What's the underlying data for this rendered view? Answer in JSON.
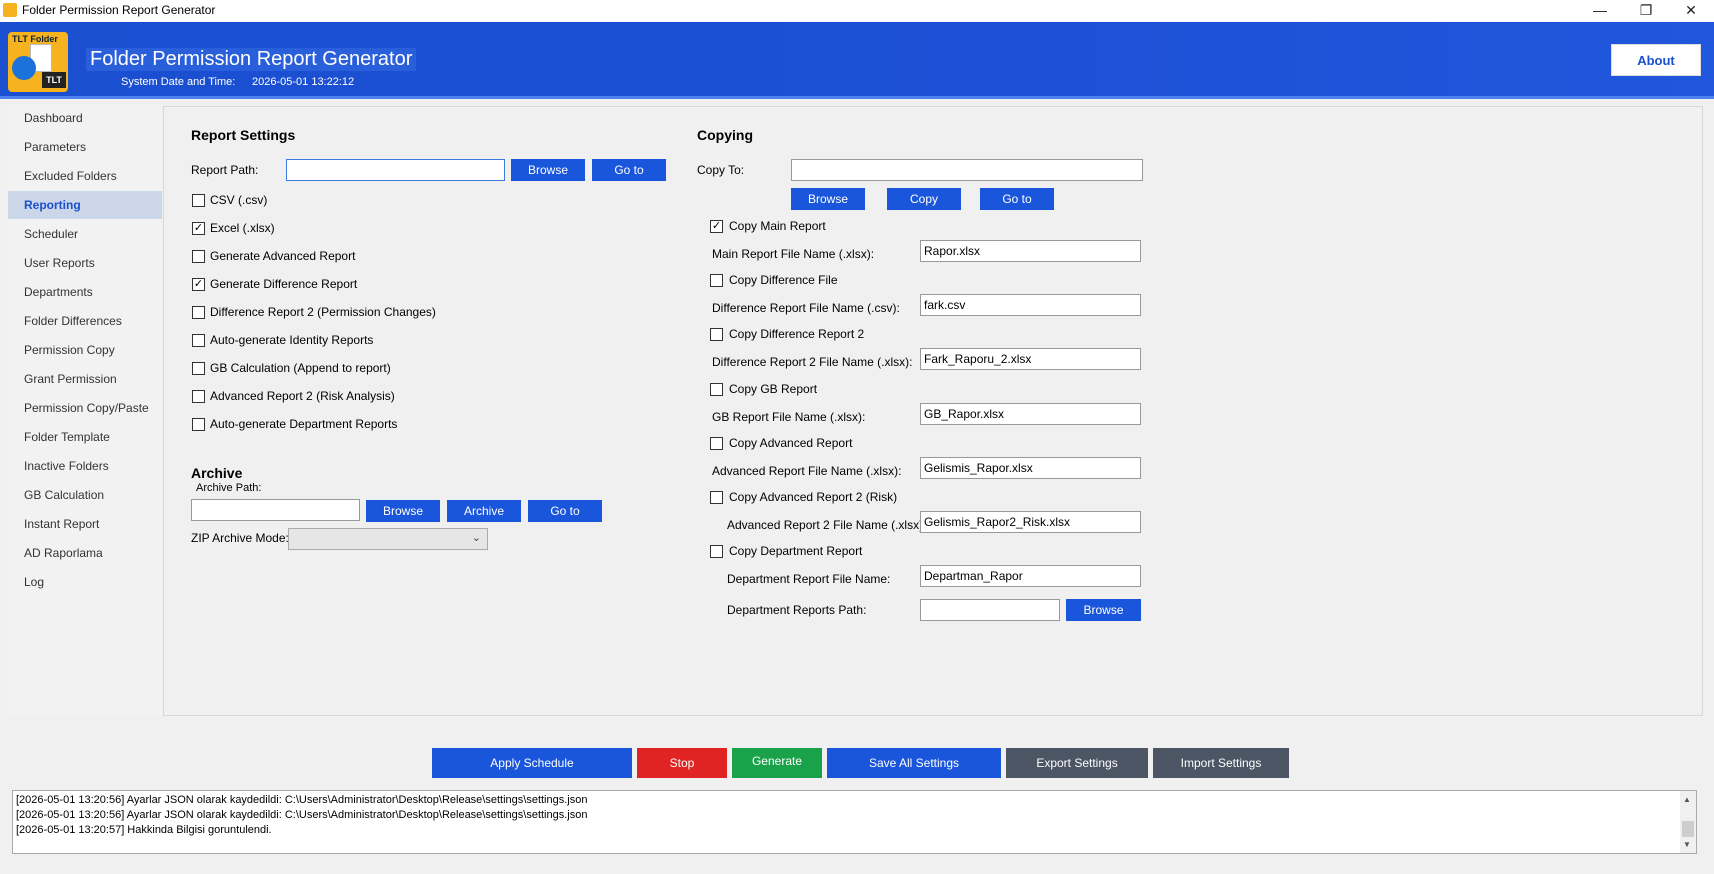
{
  "window": {
    "title": "Folder Permission Report Generator",
    "minimize": "—",
    "restore": "❐",
    "close": "✕"
  },
  "header": {
    "logo_text": "TLT Folder",
    "logo_badge": "TLT",
    "title": "Folder Permission Report Generator",
    "datetime_label": "System Date and Time:",
    "datetime_value": "2026-05-01 13:22:12",
    "about_label": "About"
  },
  "sidebar": {
    "items": [
      {
        "label": "Dashboard"
      },
      {
        "label": "Parameters"
      },
      {
        "label": "Excluded Folders"
      },
      {
        "label": "Reporting"
      },
      {
        "label": "Scheduler"
      },
      {
        "label": "User Reports"
      },
      {
        "label": "Departments"
      },
      {
        "label": "Folder Differences"
      },
      {
        "label": "Permission Copy"
      },
      {
        "label": "Grant Permission"
      },
      {
        "label": "Permission Copy/Paste"
      },
      {
        "label": "Folder Template"
      },
      {
        "label": "Inactive Folders"
      },
      {
        "label": "GB Calculation"
      },
      {
        "label": "Instant Report"
      },
      {
        "label": "AD Raporlama"
      },
      {
        "label": "Log"
      }
    ],
    "active": "Reporting"
  },
  "report_settings": {
    "heading": "Report Settings",
    "path_label": "Report Path:",
    "path_value": "",
    "browse_label": "Browse",
    "goto_label": "Go to",
    "options": [
      {
        "label": "CSV (.csv)",
        "checked": false,
        "mark": ""
      },
      {
        "label": "Excel (.xlsx)",
        "checked": true,
        "mark": "✓"
      },
      {
        "label": "Generate Advanced Report",
        "checked": false,
        "mark": ""
      },
      {
        "label": "Generate Difference Report",
        "checked": true,
        "mark": "✓"
      },
      {
        "label": "Difference Report 2 (Permission Changes)",
        "checked": false,
        "mark": ""
      },
      {
        "label": "Auto-generate Identity Reports",
        "checked": false,
        "mark": ""
      },
      {
        "label": "GB Calculation (Append to report)",
        "checked": false,
        "mark": ""
      },
      {
        "label": "Advanced Report 2 (Risk Analysis)",
        "checked": false,
        "mark": ""
      },
      {
        "label": "Auto-generate Department Reports",
        "checked": false,
        "mark": ""
      }
    ]
  },
  "archive": {
    "heading": "Archive",
    "path_label": "Archive Path:",
    "path_value": "",
    "browse_label": "Browse",
    "archive_label": "Archive",
    "goto_label": "Go to",
    "zip_mode_label": "ZIP Archive Mode:",
    "zip_mode_value": ""
  },
  "copying": {
    "heading": "Copying",
    "copy_to_label": "Copy To:",
    "copy_to_value": "",
    "browse_label": "Browse",
    "copy_label": "Copy",
    "goto_label": "Go to",
    "items": [
      {
        "check_label": "Copy Main Report",
        "checked": true,
        "mark": "✓",
        "name_label": "Main Report File Name (.xlsx):",
        "name_value": "Rapor.xlsx"
      },
      {
        "check_label": "Copy Difference File",
        "checked": false,
        "mark": "",
        "name_label": "Difference Report File Name (.csv):",
        "name_value": "fark.csv"
      },
      {
        "check_label": "Copy Difference Report 2",
        "checked": false,
        "mark": "",
        "name_label": "Difference Report 2 File Name (.xlsx):",
        "name_value": "Fark_Raporu_2.xlsx"
      },
      {
        "check_label": "Copy GB Report",
        "checked": false,
        "mark": "",
        "name_label": "GB Report File Name (.xlsx):",
        "name_value": "GB_Rapor.xlsx"
      },
      {
        "check_label": "Copy Advanced Report",
        "checked": false,
        "mark": "",
        "name_label": "Advanced Report File Name (.xlsx):",
        "name_value": "Gelismis_Rapor.xlsx"
      },
      {
        "check_label": "Copy Advanced Report 2 (Risk)",
        "checked": false,
        "mark": "",
        "name_label": "Advanced Report 2 File Name (.xlsx):",
        "name_value": "Gelismis_Rapor2_Risk.xlsx"
      },
      {
        "check_label": "Copy Department Report",
        "checked": false,
        "mark": "",
        "name_label": "Department Report File Name:",
        "name_value": "Departman_Rapor"
      }
    ],
    "dept_path_label": "Department Reports Path:",
    "dept_path_value": "",
    "dept_browse_label": "Browse"
  },
  "bottom_bar": {
    "apply_schedule": "Apply Schedule",
    "stop": "Stop",
    "generate": "Generate",
    "save_all": "Save All Settings",
    "export": "Export Settings",
    "import": "Import Settings"
  },
  "log": {
    "lines": [
      "[2026-05-01 13:20:56] Ayarlar JSON olarak kaydedildi: C:\\Users\\Administrator\\Desktop\\Release\\settings\\settings.json",
      "[2026-05-01 13:20:56] Ayarlar JSON olarak kaydedildi: C:\\Users\\Administrator\\Desktop\\Release\\settings\\settings.json",
      "[2026-05-01 13:20:57] Hakkinda Bilgisi goruntulendi."
    ]
  },
  "colors": {
    "header_blue": "#1a4fd0",
    "button_blue": "#1a56db",
    "stop_red": "#e02323",
    "generate_green": "#1aa24a",
    "gray_button": "#4b5563"
  }
}
